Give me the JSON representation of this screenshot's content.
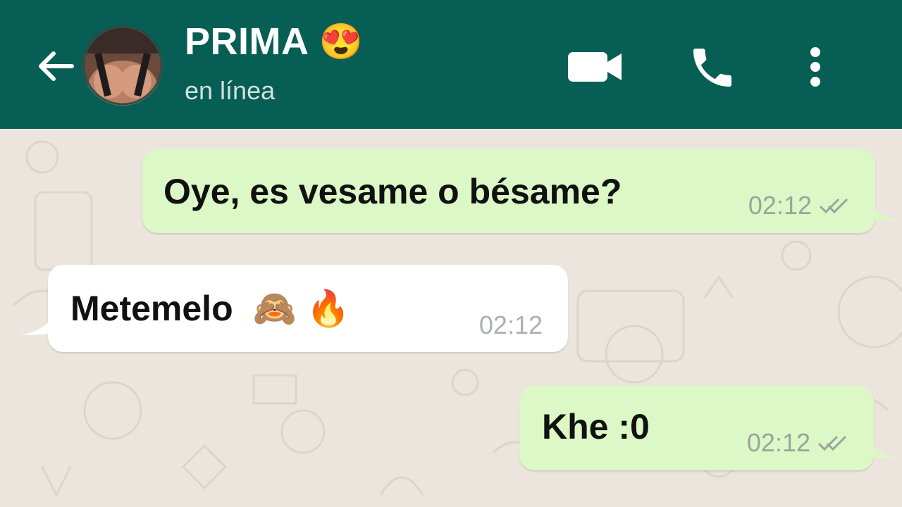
{
  "header": {
    "contact_name": "PRIMA",
    "name_emoji": "😍",
    "status": "en línea",
    "icons": [
      "back-arrow-icon",
      "avatar",
      "video-call-icon",
      "phone-call-icon",
      "more-options-icon"
    ],
    "color": "#075e54"
  },
  "messages": [
    {
      "direction": "outgoing",
      "text": "Oye, es vesame o bésame?",
      "time": "02:12",
      "status_icon": "double-check-icon"
    },
    {
      "direction": "incoming",
      "text": "Metemelo",
      "emojis": "🙈 🔥",
      "time": "02:12"
    },
    {
      "direction": "outgoing",
      "text": "Khe :0",
      "time": "02:12",
      "status_icon": "double-check-icon"
    }
  ],
  "colors": {
    "outgoing_bubble": "#dcf8c6",
    "incoming_bubble": "#ffffff",
    "chat_background": "#ece5dd"
  }
}
